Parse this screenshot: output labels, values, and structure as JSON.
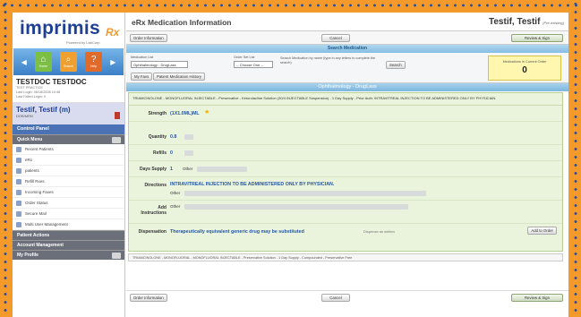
{
  "sidebar": {
    "logo": "imprimis",
    "logo_rx": "Rx",
    "tagline": "Powered by LabCorp",
    "nav": [
      {
        "label": "Home"
      },
      {
        "label": "Search"
      },
      {
        "label": "Help"
      }
    ],
    "user_name": "TESTDOC TESTDOC",
    "user_role": "TEST PRACTICE",
    "last_login": "Last Login: 06/18/2008 10:46",
    "last_failed": "Last Failed Login: 0",
    "patient_name": "Testif, Testif (m)",
    "patient_info": "DOB/MRN",
    "control_panel": "Control Panel",
    "quick_menu": "Quick Menu",
    "menu_items": [
      "Recent Patients",
      "eRx",
      "patients",
      "Refill Rxes",
      "Incoming Faxes",
      "Order Status",
      "Secure Mail",
      "Multi User Management"
    ],
    "patient_actions": "Patient Actions",
    "account_management": "Account Management",
    "my_profile": "My Profile"
  },
  "header": {
    "title": "eRx Medication Information",
    "user": "Testif, Testif",
    "user_sub": "(Pre-existing)"
  },
  "toolbar": {
    "order_info": "Order Information",
    "cancel": "Cancel",
    "review_sign": "Review & Sign"
  },
  "search": {
    "bar_label": "Search Medication",
    "select1_label": "Medication List",
    "select1_value": "Ophthalmology - DrugLass",
    "select2_label": "Order Set List",
    "select2_value": "-- Choose One --",
    "hint": "Search Medication by name (type in any letters to complete the search)",
    "search_btn": "Search",
    "btn_favs": "My Favs",
    "btn_patient_history": "Patient Medication History",
    "current_order_label": "Medications in Current Order",
    "current_order_count": "0"
  },
  "panel_title": "Ophthalmology - DrugLass",
  "rx": {
    "title": "TRIAMCINOLONE - MONOFLUORAL INJECTABLE - Preservative - Ketorolacline Solution (30/4 INJECTABLE Suspension) - 1 Day Supply - Prior Auth: INTRAVITREAL INJECTION TO BE ADMINISTERED ONLY BY PHYSICIAN.",
    "strength_label": "Strength",
    "strength_value": "(1X1.0ML)ML",
    "quantity_label": "Quantity",
    "quantity_value": "0.8",
    "refills_label": "Refills",
    "refills_value": "0",
    "days_label": "Days Supply",
    "days_value": "1",
    "other": "Other",
    "directions_label": "Directions",
    "directions_value": "INTRAVITREAL INJECTION TO BE ADMINISTERED ONLY BY PHYSICIAN.",
    "add_instr_label": "Add Instructions",
    "dispensation_label": "Dispensation",
    "dispensation_value": "Therapeutically equivalent generic drug may be substituted",
    "dispense_written": "Dispense as written",
    "add_to_order": "Add to Order"
  },
  "next_item": "TRIAMCINOLONE - MONOFLUORAL - MONOFLUORAL INJECTABLE - Preservative Solution - 1 Day Supply - Compounded - Preservative Free",
  "footer": {
    "order_info": "Order Information",
    "cancel": "Cancel",
    "review_sign": "Review & Sign"
  },
  "colors": {
    "border": "#f39a2b",
    "dots": "#2b4f9e",
    "brand": "#1f3f95"
  }
}
